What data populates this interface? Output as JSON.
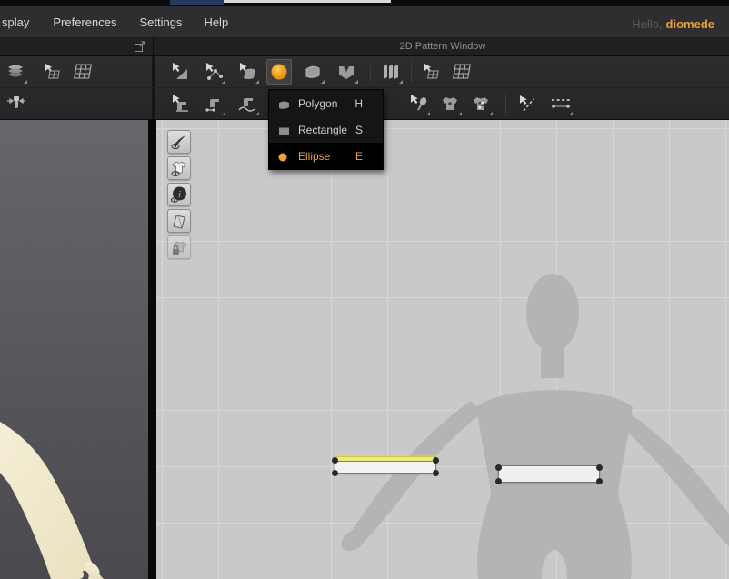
{
  "menu": {
    "items": [
      "splay",
      "Preferences",
      "Settings",
      "Help"
    ]
  },
  "user": {
    "greeting": "Hello,",
    "name": "diomede",
    "name_color": "#e8a23b"
  },
  "window": {
    "title_2d": "2D Pattern Window"
  },
  "tool_dropdown": {
    "items": [
      {
        "icon": "polygon-icon",
        "label": "Polygon",
        "shortcut": "H",
        "selected": false
      },
      {
        "icon": "rectangle-icon",
        "label": "Rectangle",
        "shortcut": "S",
        "selected": false
      },
      {
        "icon": "ellipse-icon",
        "label": "Ellipse",
        "shortcut": "E",
        "selected": true
      }
    ],
    "selected_label": "Ellipse",
    "highlight_color": "#e8a23b"
  },
  "toolbar_icons": {
    "row1": [
      "layers-icon",
      "select-grid-icon",
      "grid-icon",
      "transform-pattern-icon",
      "edit-pattern-icon",
      "edit-curvature-icon",
      "ellipse-tool-icon",
      "polygon-tool-icon",
      "dart-icon",
      "pleats-icon",
      "select-grid-icon",
      "grid-icon"
    ],
    "row2": [
      "pin-icon",
      "edit-sewing-icon",
      "segment-sewing-icon",
      "free-sewing-icon",
      "tack-icon",
      "shirt-cross-icon",
      "shirt-check-icon",
      "seam-arrow-icon",
      "seamline-icon"
    ],
    "selected_tool": "ellipse-tool-icon",
    "accent_orange": "#f0a32e"
  },
  "pattern_window": {
    "side_toggles": [
      "needle-visibility-toggle",
      "garment-visibility-toggle",
      "info-visibility-toggle",
      "fabric-visibility-toggle",
      "pattern-lock-toggle"
    ],
    "pieces": [
      {
        "name": "strip-pattern-selected",
        "selected_edge_color": "#ecec7a"
      },
      {
        "name": "strip-pattern"
      }
    ],
    "grid_color": "#d7d7d8",
    "background": "#c9c9ca"
  }
}
